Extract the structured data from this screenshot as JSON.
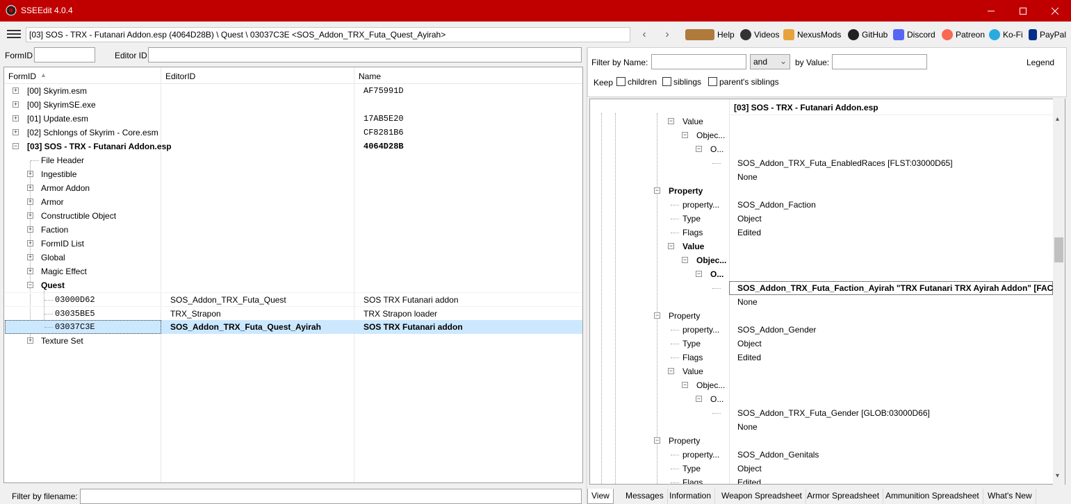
{
  "window": {
    "title": "SSEEdit 4.0.4"
  },
  "toolbar": {
    "path": "[03] SOS - TRX - Futanari Addon.esp (4064D28B) \\ Quest \\ 03037C3E <SOS_Addon_TRX_Futa_Quest_Ayirah>",
    "links": [
      "Help",
      "Videos",
      "NexusMods",
      "GitHub",
      "Discord",
      "Patreon",
      "Ko-Fi",
      "PayPal"
    ]
  },
  "left": {
    "formid_label": "FormID",
    "editorid_label": "Editor ID",
    "formid_value": "",
    "editorid_value": "",
    "columns": [
      "FormID",
      "EditorID",
      "Name"
    ],
    "rows": [
      {
        "c1": "[00] Skyrim.esm",
        "c2": "",
        "c3": "AF75991D"
      },
      {
        "c1": "[00] SkyrimSE.exe",
        "c2": "",
        "c3": ""
      },
      {
        "c1": "[01] Update.esm",
        "c2": "",
        "c3": "17AB5E20"
      },
      {
        "c1": "[02] Schlongs of Skyrim - Core.esm",
        "c2": "",
        "c3": "CF8281B6"
      },
      {
        "c1": "[03] SOS - TRX - Futanari Addon.esp",
        "c2": "",
        "c3": "4064D28B"
      },
      {
        "c1": "File Header",
        "c2": "",
        "c3": ""
      },
      {
        "c1": "Ingestible",
        "c2": "",
        "c3": ""
      },
      {
        "c1": "Armor Addon",
        "c2": "",
        "c3": ""
      },
      {
        "c1": "Armor",
        "c2": "",
        "c3": ""
      },
      {
        "c1": "Constructible Object",
        "c2": "",
        "c3": ""
      },
      {
        "c1": "Faction",
        "c2": "",
        "c3": ""
      },
      {
        "c1": "FormID List",
        "c2": "",
        "c3": ""
      },
      {
        "c1": "Global",
        "c2": "",
        "c3": ""
      },
      {
        "c1": "Magic Effect",
        "c2": "",
        "c3": ""
      },
      {
        "c1": "Quest",
        "c2": "",
        "c3": ""
      },
      {
        "c1": "03000D62",
        "c2": "SOS_Addon_TRX_Futa_Quest",
        "c3": "SOS TRX Futanari addon"
      },
      {
        "c1": "03035BE5",
        "c2": "TRX_Strapon",
        "c3": "TRX Strapon loader"
      },
      {
        "c1": "03037C3E",
        "c2": "SOS_Addon_TRX_Futa_Quest_Ayirah",
        "c3": "SOS TRX Futanari addon"
      },
      {
        "c1": "Texture Set",
        "c2": "",
        "c3": ""
      }
    ],
    "filter_label": "Filter by filename:",
    "filter_value": ""
  },
  "right": {
    "filter_name_label": "Filter by Name:",
    "filter_name_value": "",
    "op_value": "and",
    "by_value_label": "by Value:",
    "by_value_value": "",
    "legend": "Legend",
    "keep": "Keep",
    "children": "children",
    "siblings": "siblings",
    "parents_siblings": "parent's siblings",
    "header": "[03] SOS - TRX - Futanari Addon.esp",
    "rows": [
      {
        "n": "Value",
        "v": ""
      },
      {
        "n": "Objec...",
        "v": ""
      },
      {
        "n": "O...",
        "v": ""
      },
      {
        "n": "",
        "v": "SOS_Addon_TRX_Futa_EnabledRaces [FLST:03000D65]"
      },
      {
        "n": "",
        "v": "None"
      },
      {
        "n": "Property",
        "v": ""
      },
      {
        "n": "property...",
        "v": "SOS_Addon_Faction"
      },
      {
        "n": "Type",
        "v": "Object"
      },
      {
        "n": "Flags",
        "v": "Edited"
      },
      {
        "n": "Value",
        "v": ""
      },
      {
        "n": "Objec...",
        "v": ""
      },
      {
        "n": "O...",
        "v": ""
      },
      {
        "n": "",
        "v": "SOS_Addon_TRX_Futa_Faction_Ayirah \"TRX Futanari TRX Ayirah Addon\" [FACT:..."
      },
      {
        "n": "",
        "v": "None"
      },
      {
        "n": "Property",
        "v": ""
      },
      {
        "n": "property...",
        "v": "SOS_Addon_Gender"
      },
      {
        "n": "Type",
        "v": "Object"
      },
      {
        "n": "Flags",
        "v": "Edited"
      },
      {
        "n": "Value",
        "v": ""
      },
      {
        "n": "Objec...",
        "v": ""
      },
      {
        "n": "O...",
        "v": ""
      },
      {
        "n": "",
        "v": "SOS_Addon_TRX_Futa_Gender [GLOB:03000D66]"
      },
      {
        "n": "",
        "v": "None"
      },
      {
        "n": "Property",
        "v": ""
      },
      {
        "n": "property...",
        "v": "SOS_Addon_Genitals"
      },
      {
        "n": "Type",
        "v": "Object"
      },
      {
        "n": "Flags",
        "v": "Edited"
      }
    ],
    "tabs": [
      "View",
      "Messages",
      "Information",
      "Weapon Spreadsheet",
      "Armor Spreadsheet",
      "Ammunition Spreadsheet",
      "What's New"
    ]
  }
}
